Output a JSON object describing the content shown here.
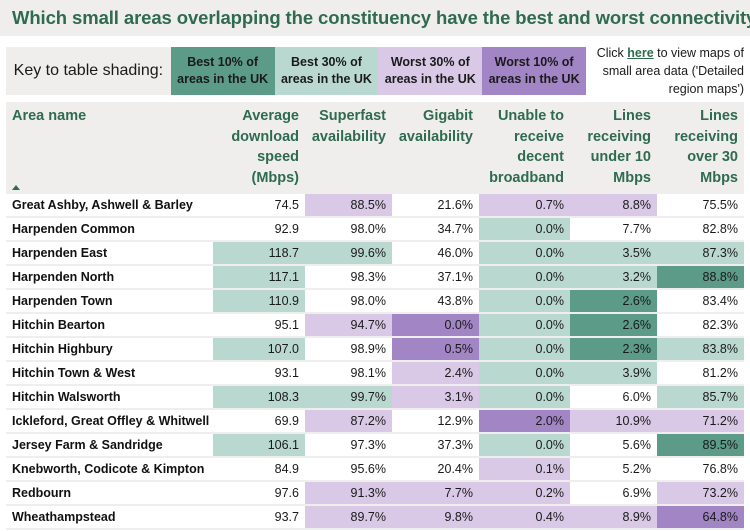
{
  "title": "Which small areas overlapping the constituency have the best and worst connectivity?",
  "key": {
    "label": "Key to table shading:",
    "items": [
      {
        "code": "b10",
        "label": "Best 10% of areas in the UK",
        "color": "#5b9b88"
      },
      {
        "code": "b30",
        "label": "Best 30% of areas in the UK",
        "color": "#b9d9d0"
      },
      {
        "code": "w30",
        "label": "Worst 30% of areas in the UK",
        "color": "#d9c9e6"
      },
      {
        "code": "w10",
        "label": "Worst 10% of areas in the UK",
        "color": "#a285c5"
      }
    ]
  },
  "maps_note": {
    "prefix": "Click ",
    "link": "here",
    "suffix": " to view maps of small area data ('Detailed region maps')"
  },
  "table": {
    "sort_icon": "sort-ascending-icon",
    "headers": [
      "Area name",
      "Average download speed (Mbps)",
      "Superfast availability",
      "Gigabit availability",
      "Unable to receive decent broadband",
      "Lines receiving under 10 Mbps",
      "Lines receiving over 30 Mbps"
    ],
    "rows": [
      {
        "name": "Great Ashby, Ashwell & Barley",
        "values": [
          "74.5",
          "88.5%",
          "21.6%",
          "0.7%",
          "8.8%",
          "75.5%"
        ],
        "shading": [
          "none",
          "w30",
          "none",
          "w30",
          "w30",
          "none"
        ]
      },
      {
        "name": "Harpenden Common",
        "values": [
          "92.9",
          "98.0%",
          "34.7%",
          "0.0%",
          "7.7%",
          "82.8%"
        ],
        "shading": [
          "none",
          "none",
          "none",
          "b30",
          "none",
          "none"
        ]
      },
      {
        "name": "Harpenden East",
        "values": [
          "118.7",
          "99.6%",
          "46.0%",
          "0.0%",
          "3.5%",
          "87.3%"
        ],
        "shading": [
          "b30",
          "b30",
          "none",
          "b30",
          "b30",
          "b30"
        ]
      },
      {
        "name": "Harpenden North",
        "values": [
          "117.1",
          "98.3%",
          "37.1%",
          "0.0%",
          "3.2%",
          "88.8%"
        ],
        "shading": [
          "b30",
          "none",
          "none",
          "b30",
          "b30",
          "b10"
        ]
      },
      {
        "name": "Harpenden Town",
        "values": [
          "110.9",
          "98.0%",
          "43.8%",
          "0.0%",
          "2.6%",
          "83.4%"
        ],
        "shading": [
          "b30",
          "none",
          "none",
          "b30",
          "b10",
          "none"
        ]
      },
      {
        "name": "Hitchin Bearton",
        "values": [
          "95.1",
          "94.7%",
          "0.0%",
          "0.0%",
          "2.6%",
          "82.3%"
        ],
        "shading": [
          "none",
          "w30",
          "w10",
          "b30",
          "b10",
          "none"
        ]
      },
      {
        "name": "Hitchin Highbury",
        "values": [
          "107.0",
          "98.9%",
          "0.5%",
          "0.0%",
          "2.3%",
          "83.8%"
        ],
        "shading": [
          "b30",
          "none",
          "w10",
          "b30",
          "b10",
          "b30"
        ]
      },
      {
        "name": "Hitchin Town & West",
        "values": [
          "93.1",
          "98.1%",
          "2.4%",
          "0.0%",
          "3.9%",
          "81.2%"
        ],
        "shading": [
          "none",
          "none",
          "w30",
          "b30",
          "b30",
          "none"
        ]
      },
      {
        "name": "Hitchin Walsworth",
        "values": [
          "108.3",
          "99.7%",
          "3.1%",
          "0.0%",
          "6.0%",
          "85.7%"
        ],
        "shading": [
          "b30",
          "b30",
          "w30",
          "b30",
          "none",
          "b30"
        ]
      },
      {
        "name": "Ickleford, Great Offley & Whitwell",
        "values": [
          "69.9",
          "87.2%",
          "12.9%",
          "2.0%",
          "10.9%",
          "71.2%"
        ],
        "shading": [
          "none",
          "w30",
          "none",
          "w10",
          "w30",
          "w30"
        ]
      },
      {
        "name": "Jersey Farm & Sandridge",
        "values": [
          "106.1",
          "97.3%",
          "37.3%",
          "0.0%",
          "5.6%",
          "89.5%"
        ],
        "shading": [
          "b30",
          "none",
          "none",
          "b30",
          "none",
          "b10"
        ]
      },
      {
        "name": "Knebworth, Codicote & Kimpton",
        "values": [
          "84.9",
          "95.6%",
          "20.4%",
          "0.1%",
          "5.2%",
          "76.8%"
        ],
        "shading": [
          "none",
          "none",
          "none",
          "w30",
          "none",
          "none"
        ]
      },
      {
        "name": "Redbourn",
        "values": [
          "97.6",
          "91.3%",
          "7.7%",
          "0.2%",
          "6.9%",
          "73.2%"
        ],
        "shading": [
          "none",
          "w30",
          "w30",
          "w30",
          "none",
          "w30"
        ]
      },
      {
        "name": "Wheathampstead",
        "values": [
          "93.7",
          "89.7%",
          "9.8%",
          "0.4%",
          "8.9%",
          "64.8%"
        ],
        "shading": [
          "none",
          "w30",
          "w30",
          "w30",
          "w30",
          "w10"
        ]
      }
    ]
  }
}
